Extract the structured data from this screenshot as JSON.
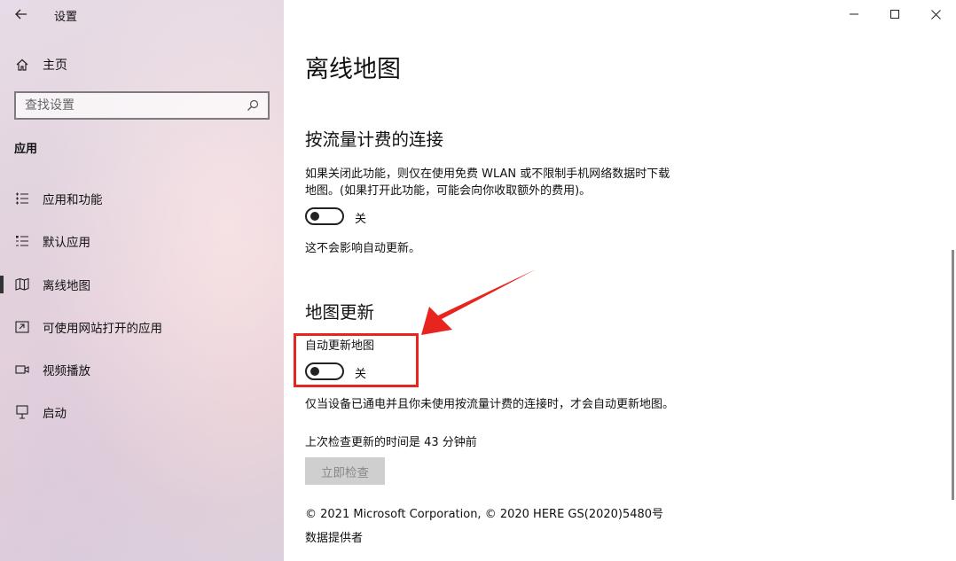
{
  "window": {
    "title": "设置",
    "controls": {
      "minimize": "—",
      "maximize": "☐",
      "close": "✕"
    }
  },
  "sidebar": {
    "home_label": "主页",
    "search": {
      "placeholder": "查找设置"
    },
    "section_label": "应用",
    "items": [
      {
        "label": "应用和功能",
        "icon": "apps-features-icon",
        "active": false
      },
      {
        "label": "默认应用",
        "icon": "default-apps-icon",
        "active": false
      },
      {
        "label": "离线地图",
        "icon": "offline-maps-icon",
        "active": true
      },
      {
        "label": "可使用网站打开的应用",
        "icon": "apps-for-websites-icon",
        "active": false
      },
      {
        "label": "视频播放",
        "icon": "video-playback-icon",
        "active": false
      },
      {
        "label": "启动",
        "icon": "startup-icon",
        "active": false
      }
    ]
  },
  "main": {
    "title": "离线地图",
    "metered": {
      "heading": "按流量计费的连接",
      "description_line1": "如果关闭此功能，则仅在使用免费 WLAN 或不限制手机网络数据时下载",
      "description_line2": "地图。(如果打开此功能，可能会向你收取额外的费用)。",
      "toggle_state": "关",
      "note": "这不会影响自动更新。"
    },
    "map_updates": {
      "heading": "地图更新",
      "toggle_label": "自动更新地图",
      "toggle_state": "关",
      "description": "仅当设备已通电并且你未使用按流量计费的连接时，才会自动更新地图。",
      "last_checked": "上次检查更新的时间是 43 分钟前",
      "check_button": "立即检查"
    },
    "copyright": "© 2021 Microsoft Corporation, © 2020 HERE GS(2020)5480号",
    "data_providers": "数据提供者"
  },
  "colors": {
    "annotation": "#e8241f",
    "disabled_button_bg": "#cfcfcf"
  }
}
